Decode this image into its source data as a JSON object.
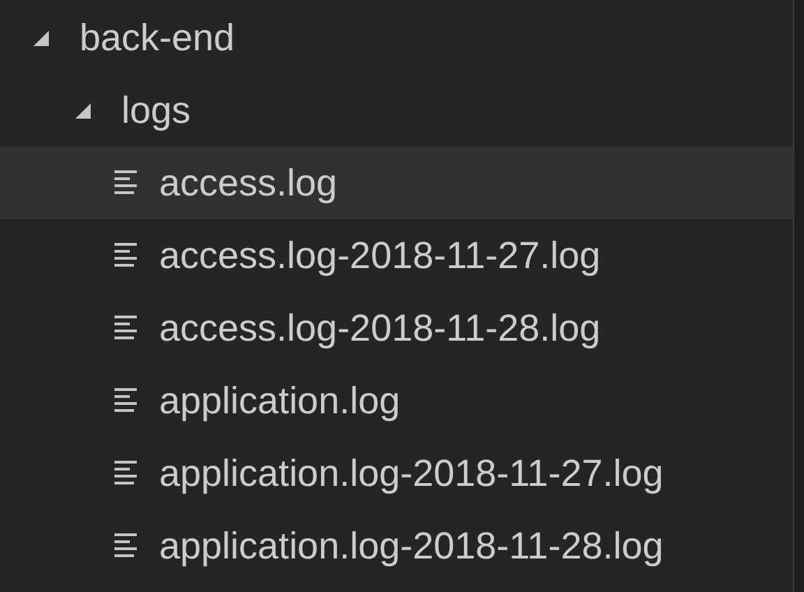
{
  "tree": [
    {
      "label": "back-end",
      "kind": "folder",
      "expanded": true,
      "selected": false,
      "children": [
        {
          "label": "logs",
          "kind": "folder",
          "expanded": true,
          "selected": false,
          "children": [
            {
              "label": "access.log",
              "kind": "file",
              "selected": true
            },
            {
              "label": "access.log-2018-11-27.log",
              "kind": "file",
              "selected": false
            },
            {
              "label": "access.log-2018-11-28.log",
              "kind": "file",
              "selected": false
            },
            {
              "label": "application.log",
              "kind": "file",
              "selected": false
            },
            {
              "label": "application.log-2018-11-27.log",
              "kind": "file",
              "selected": false
            },
            {
              "label": "application.log-2018-11-28.log",
              "kind": "file",
              "selected": false
            }
          ]
        }
      ]
    }
  ]
}
